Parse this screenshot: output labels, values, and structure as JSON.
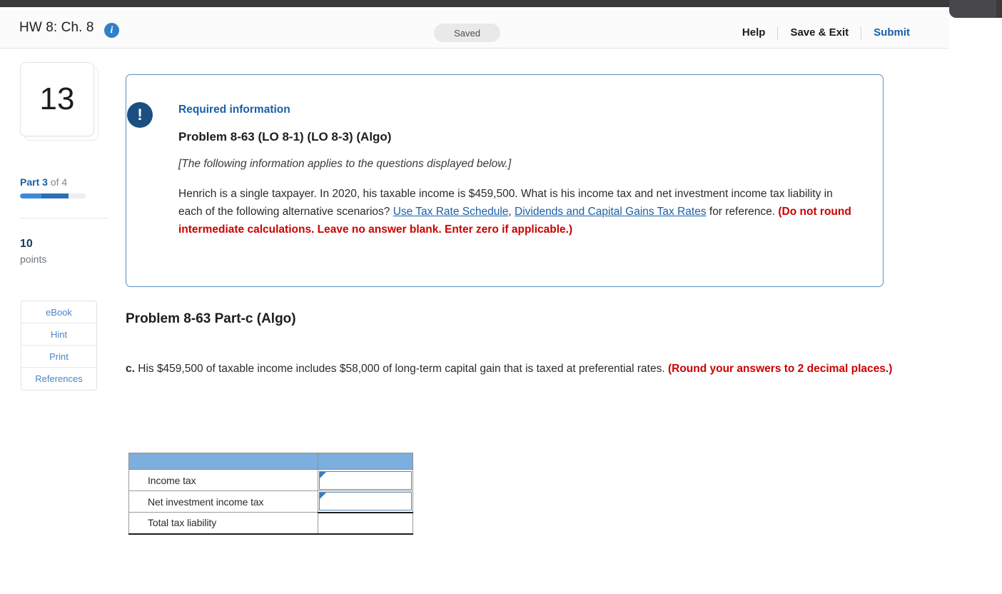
{
  "chrome": {
    "tab_icon": "browser-tab"
  },
  "header": {
    "title": "HW 8: Ch. 8",
    "info_icon_glyph": "i",
    "status_label": "Saved",
    "actions": [
      {
        "label": "Help",
        "style": "plain"
      },
      {
        "label": "Save & Exit",
        "style": "plain"
      },
      {
        "label": "Submit",
        "style": "link"
      }
    ]
  },
  "sidebar": {
    "question_number": "13",
    "part_prefix": "Part 3",
    "part_suffix": " of 4",
    "progress_percent": 74,
    "points_value": "10",
    "points_label": "points",
    "tools": [
      {
        "label": "eBook"
      },
      {
        "label": "Hint"
      },
      {
        "label": "Print"
      },
      {
        "label": "References"
      }
    ]
  },
  "required_info": {
    "badge_glyph": "!",
    "kicker": "Required information",
    "problem_title": "Problem 8-63 (LO 8-1) (LO 8-3) (Algo)",
    "applies_note": "[The following information applies to the questions displayed below.]",
    "body_part1": "Henrich is a single taxpayer. In 2020, his taxable income is $459,500. What is his income tax and net investment income tax liability in each of the following alternative scenarios? ",
    "link1": "Use Tax Rate Schedule",
    "body_comma": ", ",
    "link2": "Dividends and Capital Gains Tax Rates",
    "body_part2": " for reference. ",
    "warning": "(Do not round intermediate calculations. Leave no answer blank. Enter zero if applicable.)"
  },
  "part": {
    "heading": "Problem 8-63 Part-c (Algo)",
    "question_marker": "c.",
    "question_text": " His $459,500 of taxable income includes $58,000 of long-term capital gain that is taxed at preferential rates. ",
    "question_warning": "(Round your answers to 2 decimal places.)"
  },
  "answer_table": {
    "header": [
      "",
      ""
    ],
    "rows": [
      {
        "label": "Income tax",
        "value": "",
        "input": true
      },
      {
        "label": "Net investment income tax",
        "value": "",
        "input": true
      },
      {
        "label": "Total tax liability",
        "value": "",
        "input": false
      }
    ]
  },
  "colors": {
    "accent_blue": "#1a5fa8",
    "table_header_blue": "#7cafdd",
    "warning_red": "#cc0000",
    "badge_navy": "#1b4f82"
  }
}
